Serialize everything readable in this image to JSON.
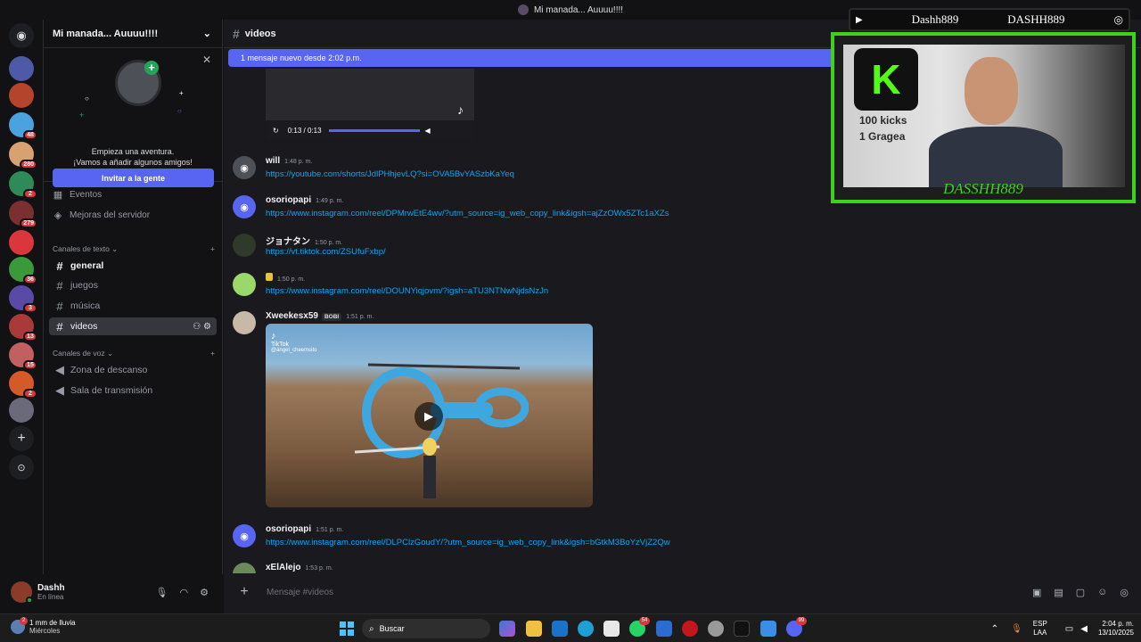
{
  "window": {
    "title": "Mi manada... Auuuu!!!!"
  },
  "rail": {
    "servers": [
      {
        "color": "#4e5aa8",
        "badge": ""
      },
      {
        "color": "#b5442c",
        "badge": ""
      },
      {
        "color": "#4aa3df",
        "badge": "48"
      },
      {
        "color": "#d9a070",
        "badge": "280"
      },
      {
        "color": "#2e8b57",
        "badge": "2"
      },
      {
        "color": "#7a3030",
        "badge": "279"
      },
      {
        "color": "#da373c",
        "badge": ""
      },
      {
        "color": "#3a9a3a",
        "badge": "36"
      },
      {
        "color": "#5a4aa8",
        "badge": "3"
      },
      {
        "color": "#a83a3a",
        "badge": "13"
      },
      {
        "color": "#c06060",
        "badge": "15"
      },
      {
        "color": "#d45a2a",
        "badge": "2"
      },
      {
        "color": "#6a6a7a",
        "badge": ""
      }
    ]
  },
  "sidebar": {
    "server_name": "Mi manada... Auuuu!!!!",
    "invite_line1": "Empieza una aventura.",
    "invite_line2": "¡Vamos a añadir algunos amigos!",
    "invite_button": "Invitar a la gente",
    "events": "Eventos",
    "boosts": "Mejoras del servidor",
    "text_category": "Canales de texto",
    "text_channels": [
      "general",
      "juegos",
      "música",
      "videos"
    ],
    "voice_category": "Canales de voz",
    "voice_channels": [
      "Zona de descanso",
      "Sala de transmisión"
    ]
  },
  "user": {
    "name": "Dashh",
    "status": "En línea"
  },
  "channel": {
    "name": "videos",
    "new_messages_bar": "1 mensaje nuevo desde 2:02 p.m.",
    "video_time": "0:13 / 0:13",
    "composer_placeholder": "Mensaje #videos"
  },
  "messages": [
    {
      "author": "will",
      "time": "1:48 p. m.",
      "text": "https://youtube.com/shorts/JdlPHhjevLQ?si=OVA5BvYASzbKaYeq"
    },
    {
      "author": "osoriopapi",
      "time": "1:49 p. m.",
      "text": "https://www.instagram.com/reel/DPMrwEtE4wv/?utm_source=ig_web_copy_link&igsh=ajZzOWx5ZTc1aXZs"
    },
    {
      "author": "ジョナタン",
      "time": "1:50 p. m.",
      "text": "https://vt.tiktok.com/ZSUfuFxbp/"
    },
    {
      "author": "",
      "time": "1:50 p. m.",
      "text": "https://www.instagram.com/reel/DOUNYiqjovm/?igsh=aTU3NTNwNjdsNzJn"
    },
    {
      "author": "Xweekesx59",
      "tag": "BOBI",
      "time": "1:51 p. m.",
      "text": ""
    },
    {
      "author": "osoriopapi",
      "time": "1:51 p. m.",
      "text": "https://www.instagram.com/reel/DLPClzGoudY/?utm_source=ig_web_copy_link&igsh=bGtkM3BoYzVjZ2Qw"
    },
    {
      "author": "xElAlejo",
      "time": "1:53 p. m.",
      "text": ""
    }
  ],
  "embed": {
    "tiktok_label": "TikTok",
    "tiktok_user": "@ángel_cheemsito"
  },
  "overlay": {
    "youtube_handle": "Dashh889",
    "instagram_handle": "DASHH889",
    "kicks": "100 kicks",
    "grageas": "1 Gragea",
    "name_banner": "DASSHH889"
  },
  "taskbar": {
    "weather_temp": "1 mm de lluvia",
    "weather_day": "Miércoles",
    "weather_badge": "2",
    "search": "Buscar",
    "whatsapp_badge": "54",
    "discord_badge": "99",
    "lang_top": "ESP",
    "lang_bottom": "LAA",
    "time": "2:04 p. m.",
    "date": "13/10/2025"
  },
  "colors": {
    "accent": "#5865f2",
    "link": "#00a8fc",
    "overlay_green": "#3fd21b",
    "kick_green": "#53fc18"
  }
}
